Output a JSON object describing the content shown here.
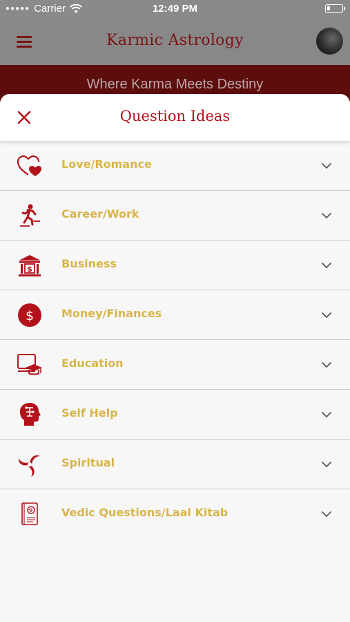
{
  "status_bar": {
    "carrier": "Carrier",
    "time": "12:49 PM"
  },
  "app": {
    "title": "Karmic Astrology",
    "tagline": "Where Karma Meets Destiny"
  },
  "sheet": {
    "title": "Question Ideas"
  },
  "categories": [
    {
      "label": "Love/Romance",
      "icon": "hearts-icon"
    },
    {
      "label": "Career/Work",
      "icon": "running-person-icon"
    },
    {
      "label": "Business",
      "icon": "bank-icon"
    },
    {
      "label": "Money/Finances",
      "icon": "dollar-icon"
    },
    {
      "label": "Education",
      "icon": "graduation-laptop-icon"
    },
    {
      "label": "Self Help",
      "icon": "head-icon"
    },
    {
      "label": "Spiritual",
      "icon": "swirl-icon"
    },
    {
      "label": "Vedic Questions/Laal Kitab",
      "icon": "book-icon"
    }
  ],
  "colors": {
    "accent": "#b3121b",
    "label": "#d8b54a",
    "maroon": "#5e0d0d"
  }
}
